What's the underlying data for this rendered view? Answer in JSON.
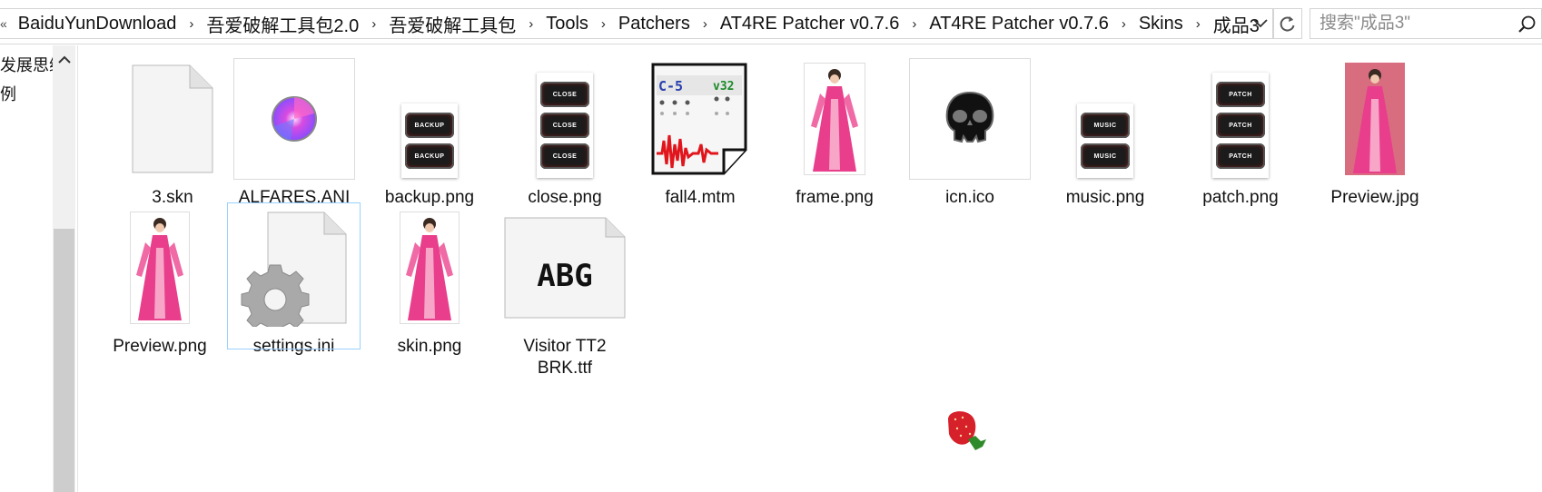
{
  "address_bar": {
    "lead_glyph": "«",
    "breadcrumbs": [
      "BaiduYunDownload",
      "吾爱破解工具包2.0",
      "吾爱破解工具包",
      "Tools",
      "Patchers",
      "AT4RE Patcher v0.7.6",
      "AT4RE Patcher v0.7.6",
      "Skins",
      "成品3"
    ],
    "separator": "›",
    "dropdown_icon": "chevron-down-icon",
    "refresh_icon": "refresh-icon"
  },
  "search": {
    "placeholder": "搜索\"成品3\"",
    "icon": "search-icon"
  },
  "nav_pane": {
    "items": [
      "发展思维",
      "例"
    ]
  },
  "files": [
    {
      "name": "3.skn",
      "icon": "blank-file-icon"
    },
    {
      "name": "ALFARES.ANI",
      "icon": "animated-cursor-icon"
    },
    {
      "name": "backup.png",
      "icon": "image-thumbnail",
      "button_text": "BACKUP"
    },
    {
      "name": "close.png",
      "icon": "image-thumbnail",
      "button_text": "CLOSE"
    },
    {
      "name": "fall4.mtm",
      "icon": "tracker-module-icon",
      "badge_left": "C-5",
      "badge_right": "v32"
    },
    {
      "name": "frame.png",
      "icon": "image-thumbnail"
    },
    {
      "name": "icn.ico",
      "icon": "skull-icon"
    },
    {
      "name": "music.png",
      "icon": "image-thumbnail",
      "button_text": "MUSIC"
    },
    {
      "name": "patch.png",
      "icon": "image-thumbnail",
      "button_text": "PATCH"
    },
    {
      "name": "Preview.jpg",
      "icon": "image-thumbnail"
    },
    {
      "name": "Preview.png",
      "icon": "image-thumbnail"
    },
    {
      "name": "settings.ini",
      "icon": "settings-file-icon",
      "selected": true
    },
    {
      "name": "skin.png",
      "icon": "image-thumbnail"
    },
    {
      "name": "Visitor TT2 BRK.ttf",
      "icon": "font-file-icon",
      "font_preview": "ABG"
    }
  ],
  "colors": {
    "accent_selection": "#99d1ff",
    "dress_pink": "#e83e8c",
    "strawberry_red": "#d6202a"
  }
}
